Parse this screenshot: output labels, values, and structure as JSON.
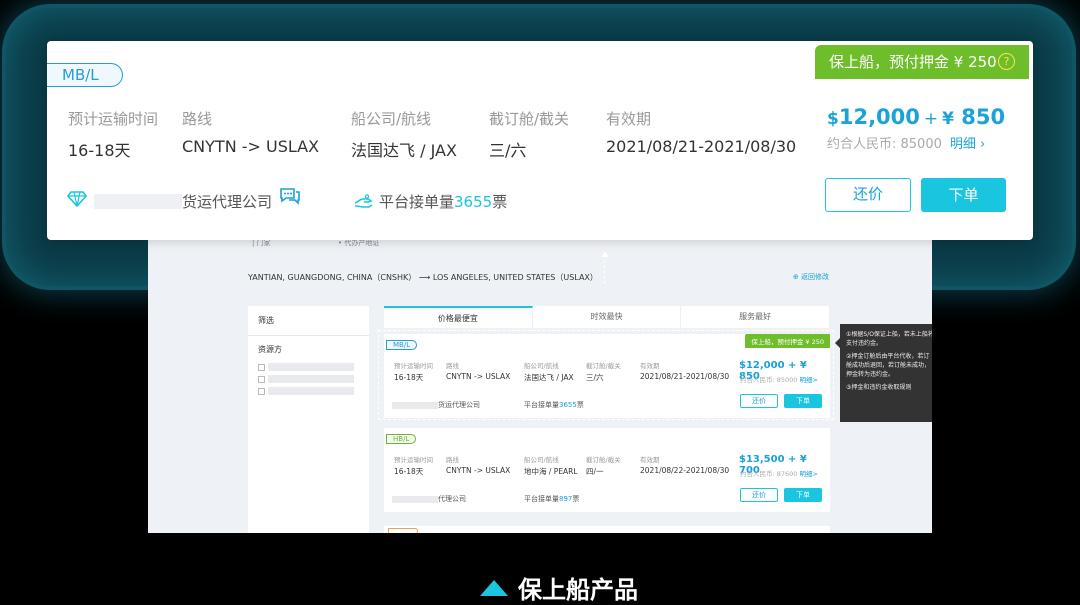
{
  "card": {
    "badge": "MB/L",
    "insurance": "保上船，预付押金 ¥ 250",
    "help": "?",
    "columns": [
      {
        "header": "预计运输时间",
        "value": "16-18天"
      },
      {
        "header": "路线",
        "value": "CNYTN -> USLAX"
      },
      {
        "header": "船公司/航线",
        "value": "法国达飞 / JAX"
      },
      {
        "header": "截订舱/截关",
        "value": "三/六"
      },
      {
        "header": "有效期",
        "value": "2021/08/21-2021/08/30"
      }
    ],
    "price": {
      "usd_sign": "$",
      "usd": "12,000",
      "plus": "+",
      "cny_sign": "¥",
      "cny": "850"
    },
    "rmb_note": "约合人民币: 85000",
    "detail": "明细",
    "company_suffix": "货运代理公司",
    "volume_prefix": "平台接单量",
    "volume_count": "3655",
    "volume_suffix": "票",
    "counter_offer": "还价",
    "order": "下单"
  },
  "background": {
    "tag1": "| 门家",
    "tag2": "• 代办产地证",
    "route": "YANTIAN, GUANGDONG, CHINA（CNSHK） ⟶ LOS ANGELES, UNITED STATES（USLAX）",
    "edit": "⊕ 返回修改",
    "filter_title": "筛选",
    "filter_source": "资源方",
    "tabs": [
      "价格最便宜",
      "时效最快",
      "服务最好"
    ],
    "tip": [
      "①根据S/O保证上船，若未上船将支付违约金。",
      "②押金订舱后由平台代收，若订舱成功后退回，若订舱未成功，押金转为违约金。",
      "③押金和违约金收取规则"
    ],
    "rows": [
      {
        "badge": "MB/L",
        "insurance": "保上船，预付押金 ¥ 250",
        "time": "16-18天",
        "route": "CNYTN -> USLAX",
        "carrier": "法国达飞 / JAX",
        "cutoff": "三/六",
        "validity": "2021/08/21-2021/08/30",
        "price": "$12,000 + ¥ 850",
        "rmb": "约合人民币: 85000",
        "detail": "明细>",
        "company": "货运代理公司",
        "volume_prefix": "平台接单量",
        "volume": "3655",
        "volume_suffix": "票"
      },
      {
        "badge": "HB/L",
        "insurance": "",
        "time": "16-18天",
        "route": "CNYTN -> USLAX",
        "carrier": "地中海 / PEARL",
        "cutoff": "四/一",
        "validity": "2021/08/22-2021/08/30",
        "price": "$13,500 + ¥ 700",
        "rmb": "约合人民币: 87600",
        "detail": "明细>",
        "company": "代理公司",
        "volume_prefix": "平台接单量",
        "volume": "897",
        "volume_suffix": "票"
      }
    ],
    "headers": [
      "预计运输时间",
      "路线",
      "船公司/航线",
      "截订舱/截关",
      "有效期"
    ],
    "btn_counter": "还价",
    "btn_order": "下单"
  },
  "caption": "保上船产品",
  "colors": {
    "accent": "#1ac5e0",
    "blue": "#1aa3d8",
    "green": "#6ebd2a",
    "glow": "#0f5563"
  }
}
